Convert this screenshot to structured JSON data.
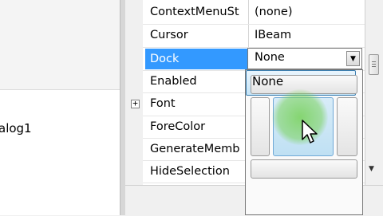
{
  "designer": {
    "component_label": "alog1"
  },
  "property_grid": {
    "rows": [
      {
        "name": "ContextMenuSt",
        "value": "(none)"
      },
      {
        "name": "Cursor",
        "value": "IBeam"
      },
      {
        "name": "Dock",
        "value": ""
      },
      {
        "name": "Enabled",
        "value": ""
      },
      {
        "name": "Font",
        "value": ""
      },
      {
        "name": "ForeColor",
        "value": ""
      },
      {
        "name": "GenerateMemb",
        "value": ""
      },
      {
        "name": "HideSelection",
        "value": ""
      }
    ],
    "expand_glyph": "+"
  },
  "dock_editor": {
    "current_value": "None",
    "dropdown_glyph": "▼",
    "none_label": "None"
  },
  "scrollbar": {
    "down_glyph": "▼"
  }
}
